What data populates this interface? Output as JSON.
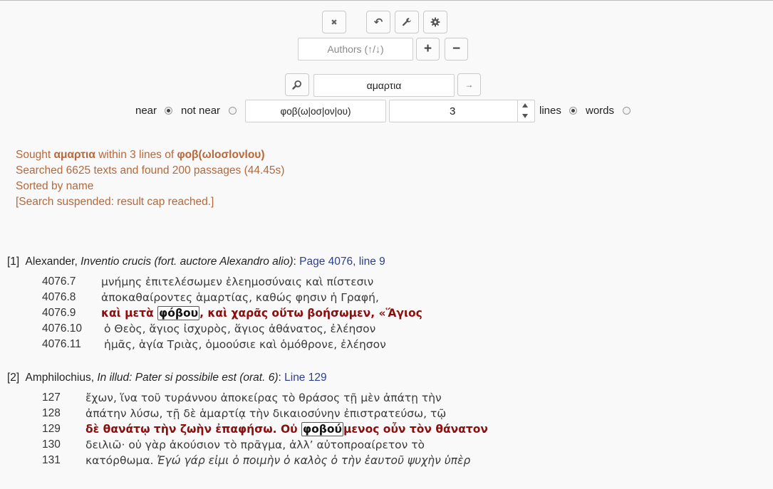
{
  "toolbar": {
    "clear_icon": "✖",
    "undo_icon": "↶",
    "wrench_icon": "🔧",
    "gear_icon": "⚙",
    "authors_placeholder": "Authors (↑/↓)",
    "plus_label": "+",
    "minus_label": "−"
  },
  "search": {
    "search_icon": "⌕",
    "query": "αμαρτια",
    "go_icon": "→",
    "near_label": "near",
    "not_near_label": "not near",
    "proximity_term": "φοβ(ω|οσ|ον|ου)",
    "distance": "3",
    "lines_label": "lines",
    "words_label": "words",
    "near_selected": true,
    "lines_selected": true
  },
  "status": {
    "line1_prefix": "Sought ",
    "line1_term": "αμαρτια",
    "line1_mid": " within 3 lines of ",
    "line1_term2": "φοβ(ωlοσlονlου)",
    "line2": "Searched 6625 texts and found 200 passages (44.45s)",
    "line3": "Sorted by name",
    "line4": "[Search suspended: result cap reached.]"
  },
  "results": [
    {
      "index": "[1]",
      "author": "Alexander,",
      "work": "Inventio crucis (fort. auctore Alexandro alio)",
      "colon": ":",
      "locus": "Page 4076, line 9",
      "lines": [
        {
          "num": "4076.7",
          "text": "μνήμης ἐπιτελέσωμεν ἐλεημοσύναις καὶ πίστεσιν"
        },
        {
          "num": "4076.8",
          "text": "ἀποκαθαίροντες ἁμαρτίας, καθώς φησιν ἡ Γραφή,"
        },
        {
          "num": "4076.9",
          "pre": "καὶ μετὰ ",
          "kw": "φόβου",
          "post": ", καὶ χαρᾶς οὕτω βοήσωμεν, «Ἅγιος"
        },
        {
          "num": "4076.10",
          "text": " ὁ Θεὸς, ἅγιος ἰσχυρὸς, ἅγιος ἀθάνατος, ἐλέησον"
        },
        {
          "num": "4076.11",
          "text": " ἡμᾶς, ἁγία Τριὰς, ὁμοούσιε καὶ ὁμόθρονε, ἐλέησον"
        }
      ]
    },
    {
      "index": "[2]",
      "author": "Amphilochius,",
      "work": "In illud: Pater si possibile est (orat. 6)",
      "colon": ":",
      "locus": "Line 129",
      "lines": [
        {
          "num": "127",
          "text": "ἔχων, ἵνα τοῦ τυράννου ἀποκείρας τὸ θράσος τῇ μὲν ἀπάτῃ τὴν"
        },
        {
          "num": "128",
          "text": "ἀπάτην λύσω, τῇ δὲ ἁμαρτίᾳ τὴν δικαιοσύνην ἐπιστρατεύσω, τῷ"
        },
        {
          "num": "129",
          "pre": "δὲ θανάτῳ τὴν ζωὴν ἐπαφήσω. Οὐ ",
          "kw": "φοβού",
          "post": "μενος οὖν τὸν θάνατον"
        },
        {
          "num": "130",
          "text": "δειλιῶ· οὐ γὰρ ἀκούσιον τὸ πρᾶγμα, ἀλλ’ αὐτοπροαίρετον τὸ"
        },
        {
          "num": "131",
          "text": "κατόρθωμα. ",
          "italic": "Ἐγώ γάρ εἰμι ὁ ποιμὴν ὁ καλὸς ὁ τὴν ἑαυτοῦ ψυχὴν ὑπὲρ"
        }
      ]
    }
  ]
}
